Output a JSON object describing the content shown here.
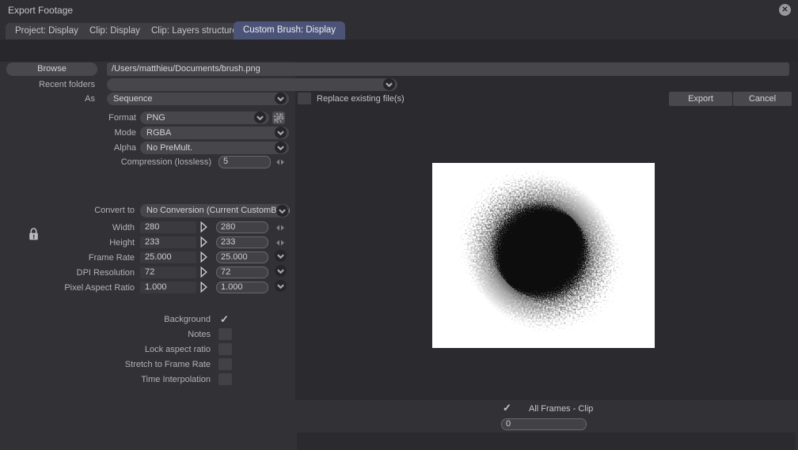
{
  "window": {
    "title": "Export Footage"
  },
  "tabs": [
    {
      "label": "Project: Display"
    },
    {
      "label": "Clip: Display"
    },
    {
      "label": "Clip: Layers structure"
    },
    {
      "label": "Custom Brush: Display"
    }
  ],
  "file": {
    "browse_label": "Browse",
    "path": "/Users/matthieu/Documents/brush.png",
    "recent_folders_label": "Recent folders",
    "recent_folders_value": "",
    "as_label": "As",
    "as_value": "Sequence",
    "replace_label": "Replace existing file(s)",
    "replace_checked": false
  },
  "actions": {
    "export_label": "Export",
    "cancel_label": "Cancel"
  },
  "format": {
    "format_label": "Format",
    "format_value": "PNG",
    "mode_label": "Mode",
    "mode_value": "RGBA",
    "alpha_label": "Alpha",
    "alpha_value": "No PreMult.",
    "compression_label": "Compression (lossless)",
    "compression_value": "5"
  },
  "convert": {
    "label": "Convert to",
    "value": "No Conversion (Current CustomBrush)",
    "rows": [
      {
        "label": "Width",
        "source": "280",
        "target": "280",
        "control": "arrows"
      },
      {
        "label": "Height",
        "source": "233",
        "target": "233",
        "control": "arrows"
      },
      {
        "label": "Frame Rate",
        "source": "25.000",
        "target": "25.000",
        "control": "dropdown"
      },
      {
        "label": "DPI Resolution",
        "source": "72",
        "target": "72",
        "control": "dropdown"
      },
      {
        "label": "Pixel Aspect Ratio",
        "source": "1.000",
        "target": "1.000",
        "control": "dropdown"
      }
    ],
    "locked": true
  },
  "options": [
    {
      "label": "Background",
      "checked": true
    },
    {
      "label": "Notes",
      "checked": false
    },
    {
      "label": "Lock aspect ratio",
      "checked": false
    },
    {
      "label": "Stretch to Frame Rate",
      "checked": false
    },
    {
      "label": "Time Interpolation",
      "checked": false
    }
  ],
  "preview": {
    "frames_label": "All Frames - Clip",
    "frames_checked": true,
    "frame_value": "0"
  },
  "colors": {
    "accent_tab": "#4b5377",
    "dialog_bg": "#313136",
    "panel_bg": "#2b2b2f",
    "field_bg": "#46464b",
    "preview_bg": "#ffffff"
  }
}
